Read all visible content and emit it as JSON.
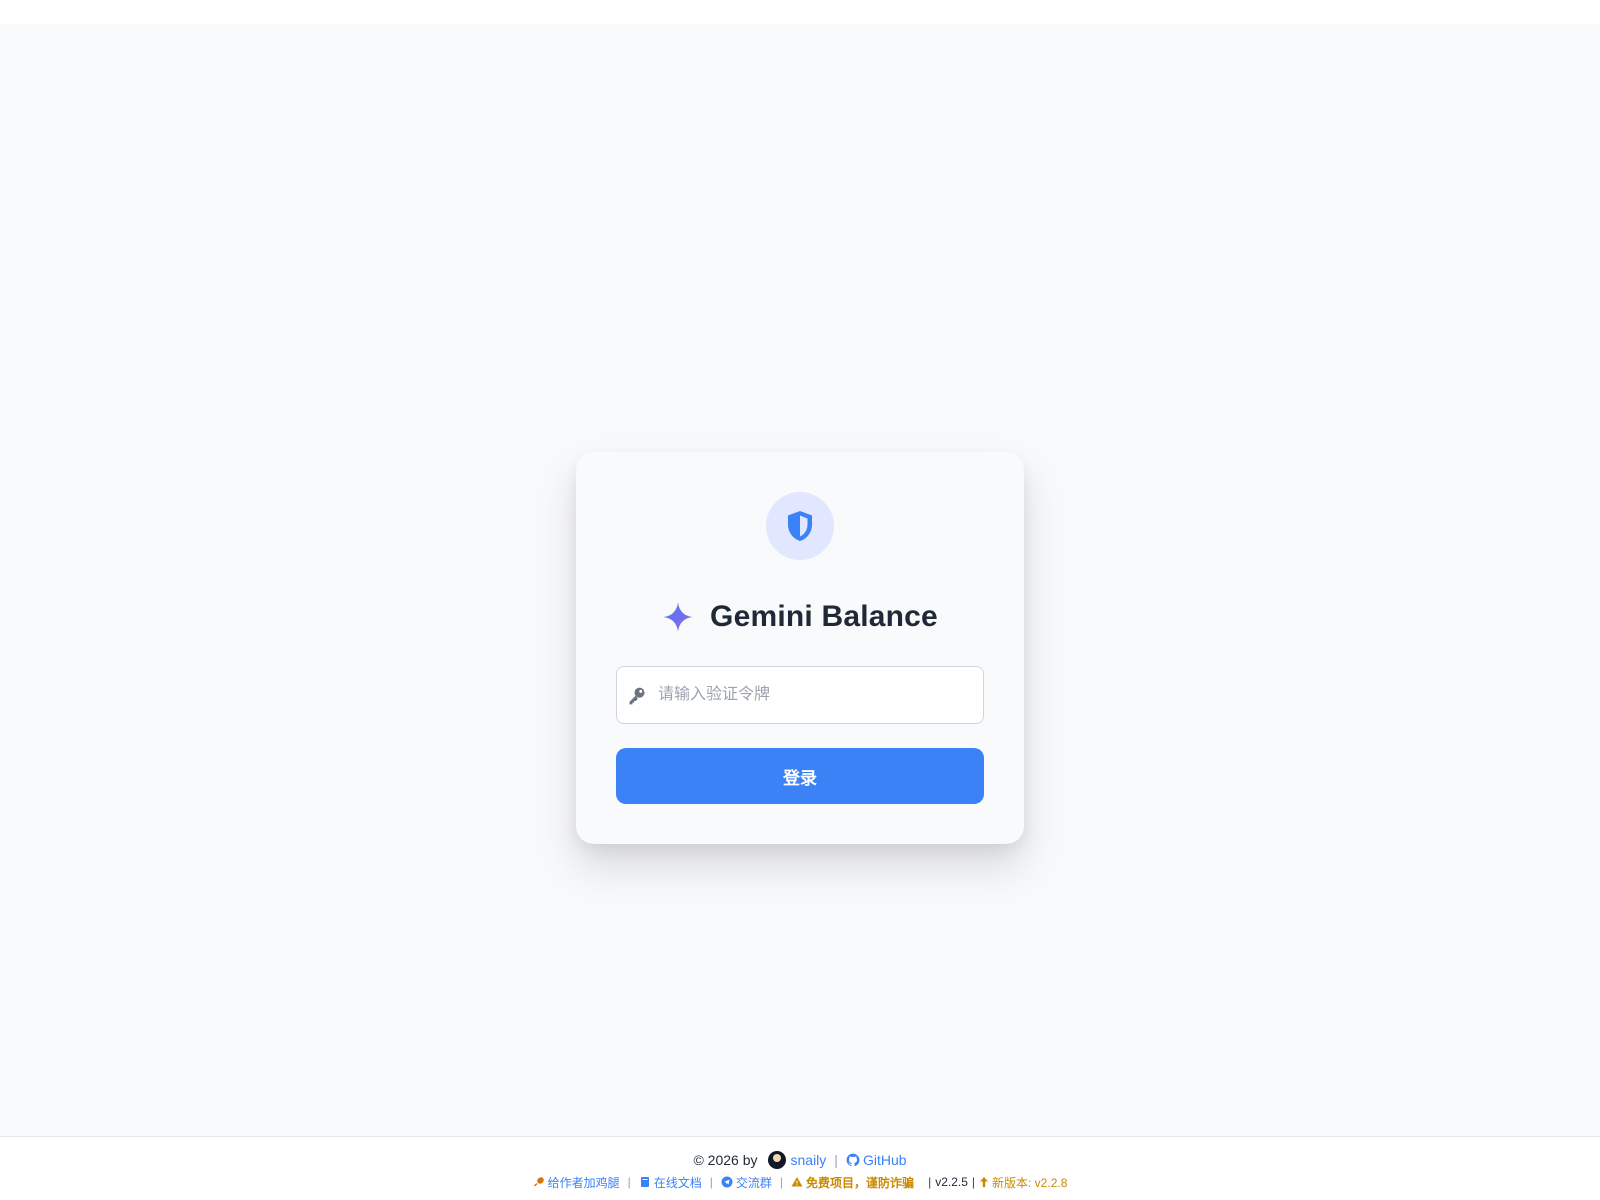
{
  "app": {
    "title": "Gemini Balance"
  },
  "login": {
    "token_placeholder": "请输入验证令牌",
    "token_value": "",
    "submit_label": "登录"
  },
  "footer": {
    "copyright": "© 2026 by",
    "author": "snaily",
    "github": "GitHub",
    "donate": "给作者加鸡腿",
    "docs": "在线文档",
    "group": "交流群",
    "warning": "免费项目，谨防诈骗",
    "version": "v2.2.5",
    "new_version": "新版本: v2.2.8",
    "separator": "|"
  },
  "colors": {
    "accent": "#3b82f6",
    "warning": "#ca8a04",
    "shield_bg": "#e0e7ff"
  },
  "icons": {
    "shield": "shield-icon",
    "sparkle": "gemini-sparkle-icon",
    "key": "key-icon",
    "github": "github-icon",
    "donate": "drumstick-icon",
    "docs": "book-icon",
    "group": "telegram-icon",
    "warning": "warning-triangle-icon",
    "update": "arrow-up-icon"
  }
}
